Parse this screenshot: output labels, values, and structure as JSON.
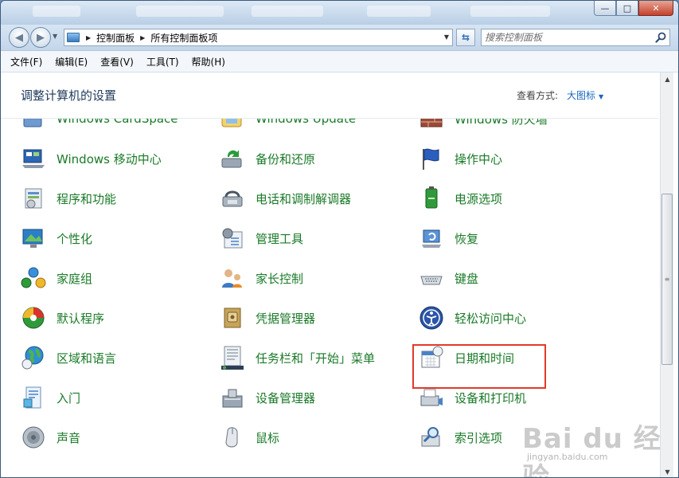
{
  "window": {
    "minimize": "—",
    "maximize": "□",
    "close": "✕"
  },
  "address": {
    "crumbs": [
      "控制面板",
      "所有控制面板项"
    ],
    "search_placeholder": "搜索控制面板"
  },
  "menu": [
    "文件(F)",
    "编辑(E)",
    "查看(V)",
    "工具(T)",
    "帮助(H)"
  ],
  "header": {
    "title": "调整计算机的设置",
    "view_by_label": "查看方式:",
    "view_by_value": "大图标"
  },
  "items": [
    {
      "label": "Windows CardSpace",
      "icon": "cardspace-icon"
    },
    {
      "label": "Windows Update",
      "icon": "windows-update-icon"
    },
    {
      "label": "Windows 防火墙",
      "icon": "firewall-icon"
    },
    {
      "label": "Windows 移动中心",
      "icon": "mobility-center-icon"
    },
    {
      "label": "备份和还原",
      "icon": "backup-restore-icon"
    },
    {
      "label": "操作中心",
      "icon": "action-center-flag-icon"
    },
    {
      "label": "程序和功能",
      "icon": "programs-features-icon"
    },
    {
      "label": "电话和调制解调器",
      "icon": "phone-modem-icon"
    },
    {
      "label": "电源选项",
      "icon": "power-battery-icon"
    },
    {
      "label": "个性化",
      "icon": "personalization-icon"
    },
    {
      "label": "管理工具",
      "icon": "admin-tools-icon"
    },
    {
      "label": "恢复",
      "icon": "recovery-icon"
    },
    {
      "label": "家庭组",
      "icon": "homegroup-icon"
    },
    {
      "label": "家长控制",
      "icon": "parental-controls-icon"
    },
    {
      "label": "键盘",
      "icon": "keyboard-icon"
    },
    {
      "label": "默认程序",
      "icon": "default-programs-icon"
    },
    {
      "label": "凭据管理器",
      "icon": "credential-manager-icon"
    },
    {
      "label": "轻松访问中心",
      "icon": "ease-of-access-icon"
    },
    {
      "label": "区域和语言",
      "icon": "region-language-globe-icon"
    },
    {
      "label": "任务栏和「开始」菜单",
      "icon": "taskbar-start-menu-icon"
    },
    {
      "label": "日期和时间",
      "icon": "date-time-calendar-icon"
    },
    {
      "label": "入门",
      "icon": "getting-started-icon"
    },
    {
      "label": "设备管理器",
      "icon": "device-manager-icon"
    },
    {
      "label": "设备和打印机",
      "icon": "devices-printers-icon"
    },
    {
      "label": "声音",
      "icon": "sound-speaker-icon"
    },
    {
      "label": "鼠标",
      "icon": "mouse-icon"
    },
    {
      "label": "索引选项",
      "icon": "indexing-options-icon"
    }
  ],
  "watermark": {
    "logo": "Bai du 经验",
    "sub": "jingyan.baidu.com"
  },
  "colors": {
    "link_green": "#1a7a28",
    "highlight_red": "#e23a2a",
    "view_blue": "#1a66c0"
  }
}
